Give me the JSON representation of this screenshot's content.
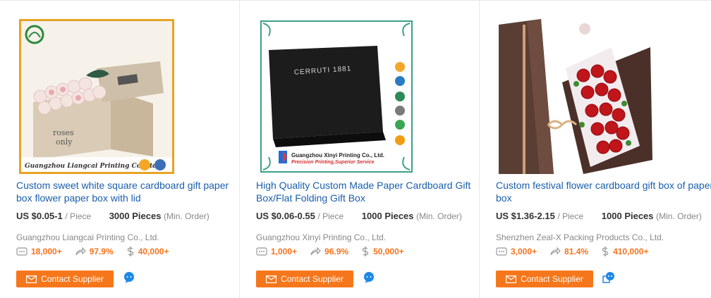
{
  "products": [
    {
      "title": "Custom sweet white square cardboard gift paper box flower paper box with lid",
      "price": "US $0.05-1",
      "price_unit": "/ Piece",
      "moq": "3000 Pieces",
      "moq_note": "(Min. Order)",
      "supplier": "Guangzhou Liangcai Printing Co., Ltd.",
      "stat_messages": "18,000+",
      "stat_response": "97.9%",
      "stat_transactions": "40,000+",
      "contact_label": "Contact Supplier",
      "image_caption": "Guangzhou Liangcai Printing Co.,Ltd",
      "box_text": "roses\nonly"
    },
    {
      "title": "High Quality Custom Made Paper Cardboard Gift Box/Flat Folding Gift Box",
      "price": "US $0.06-0.55",
      "price_unit": "/ Piece",
      "moq": "1000 Pieces",
      "moq_note": "(Min. Order)",
      "supplier": "Guangzhou Xinyi Printing Co., Ltd.",
      "stat_messages": "1,000+",
      "stat_response": "96.9%",
      "stat_transactions": "50,000+",
      "contact_label": "Contact Supplier",
      "image_caption": "Guangzhou Xinyi Printing Co., Ltd.",
      "image_tagline": "Precision Printing,Superior Service",
      "box_text": "CERRUTI 1881"
    },
    {
      "title": "Custom festival flower cardboard gift box of paper box",
      "price": "US $1.36-2.15",
      "price_unit": "/ Piece",
      "moq": "1000 Pieces",
      "moq_note": "(Min. Order)",
      "supplier": "Shenzhen Zeal-X Packing Products Co., Ltd.",
      "stat_messages": "3,000+",
      "stat_response": "81.4%",
      "stat_transactions": "410,000+",
      "contact_label": "Contact Supplier"
    }
  ],
  "colors": {
    "link": "#1a5fab",
    "accent": "#f6771b",
    "muted": "#888888",
    "chat": "#1e88e5"
  },
  "icons": {
    "messages": "message-icon",
    "response": "response-rate-icon",
    "transactions": "transaction-dollar-icon",
    "contact": "envelope-icon",
    "chat": "chat-bubble-icon"
  }
}
